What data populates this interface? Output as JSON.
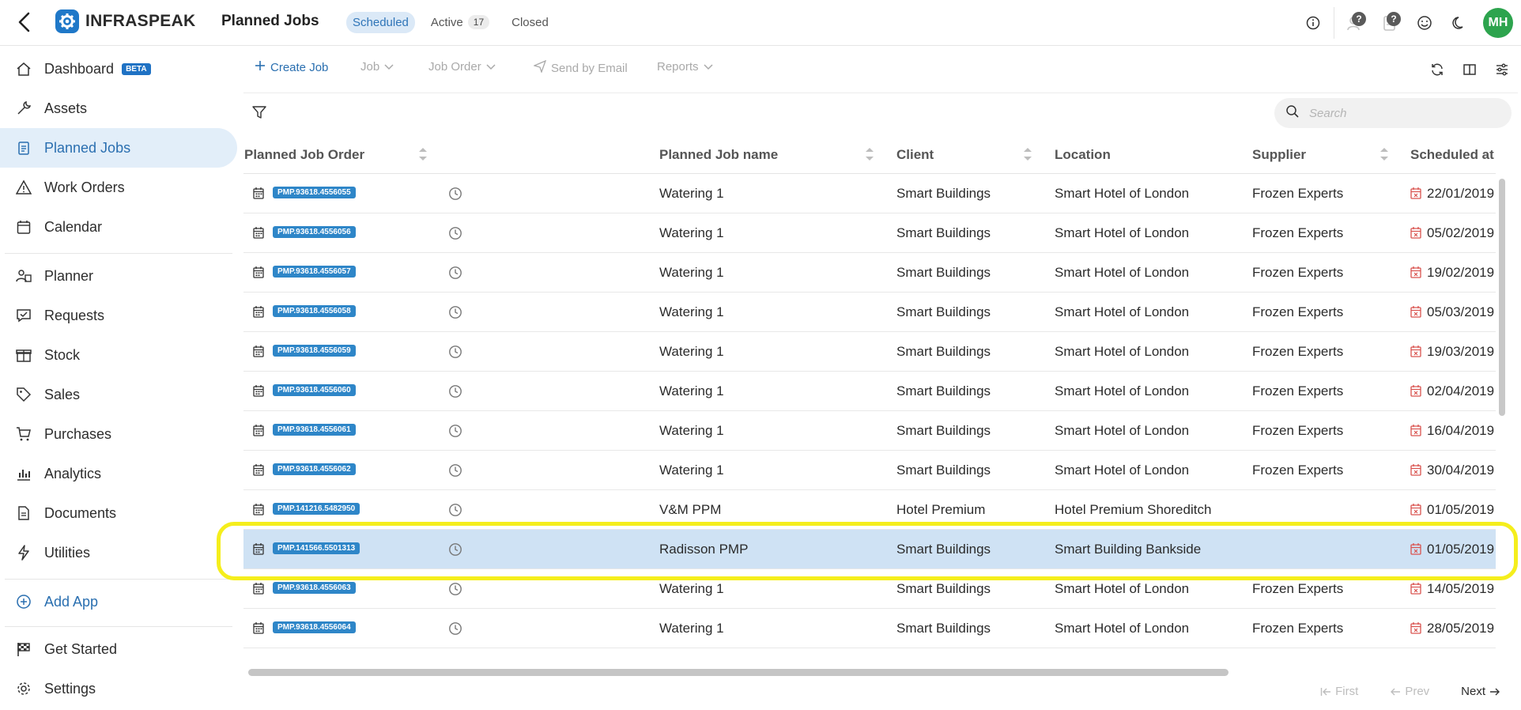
{
  "header": {
    "logo_text": "INFRASPEAK",
    "page_title": "Planned Jobs",
    "tabs": [
      {
        "label": "Scheduled",
        "active": true
      },
      {
        "label": "Active",
        "count": "17"
      },
      {
        "label": "Closed"
      }
    ],
    "help_badge": "?",
    "avatar_initials": "MH",
    "avatar_color": "#2da44e"
  },
  "sidebar": {
    "items": [
      {
        "label": "Dashboard",
        "badge": "BETA"
      },
      {
        "label": "Assets"
      },
      {
        "label": "Planned Jobs"
      },
      {
        "label": "Work Orders"
      },
      {
        "label": "Calendar"
      },
      {
        "label": "Planner"
      },
      {
        "label": "Requests"
      },
      {
        "label": "Stock"
      },
      {
        "label": "Sales"
      },
      {
        "label": "Purchases"
      },
      {
        "label": "Analytics"
      },
      {
        "label": "Documents"
      },
      {
        "label": "Utilities"
      },
      {
        "label": "Add App"
      },
      {
        "label": "Get Started"
      },
      {
        "label": "Settings"
      }
    ]
  },
  "toolbar": {
    "create_job": "Create Job",
    "job": "Job",
    "job_order": "Job Order",
    "send_email": "Send by Email",
    "reports": "Reports"
  },
  "search": {
    "placeholder": "Search"
  },
  "table": {
    "columns": [
      "Planned Job Order",
      "Planned Job name",
      "Client",
      "Location",
      "Supplier",
      "Scheduled at"
    ],
    "rows": [
      {
        "order": "PMP.93618.4556055",
        "name": "Watering 1",
        "client": "Smart Buildings",
        "location": "Smart Hotel of London",
        "supplier": "Frozen Experts",
        "date": "22/01/2019"
      },
      {
        "order": "PMP.93618.4556056",
        "name": "Watering 1",
        "client": "Smart Buildings",
        "location": "Smart Hotel of London",
        "supplier": "Frozen Experts",
        "date": "05/02/2019"
      },
      {
        "order": "PMP.93618.4556057",
        "name": "Watering 1",
        "client": "Smart Buildings",
        "location": "Smart Hotel of London",
        "supplier": "Frozen Experts",
        "date": "19/02/2019"
      },
      {
        "order": "PMP.93618.4556058",
        "name": "Watering 1",
        "client": "Smart Buildings",
        "location": "Smart Hotel of London",
        "supplier": "Frozen Experts",
        "date": "05/03/2019"
      },
      {
        "order": "PMP.93618.4556059",
        "name": "Watering 1",
        "client": "Smart Buildings",
        "location": "Smart Hotel of London",
        "supplier": "Frozen Experts",
        "date": "19/03/2019"
      },
      {
        "order": "PMP.93618.4556060",
        "name": "Watering 1",
        "client": "Smart Buildings",
        "location": "Smart Hotel of London",
        "supplier": "Frozen Experts",
        "date": "02/04/2019"
      },
      {
        "order": "PMP.93618.4556061",
        "name": "Watering 1",
        "client": "Smart Buildings",
        "location": "Smart Hotel of London",
        "supplier": "Frozen Experts",
        "date": "16/04/2019"
      },
      {
        "order": "PMP.93618.4556062",
        "name": "Watering 1",
        "client": "Smart Buildings",
        "location": "Smart Hotel of London",
        "supplier": "Frozen Experts",
        "date": "30/04/2019"
      },
      {
        "order": "PMP.141216.5482950",
        "name": "V&M PPM",
        "client": "Hotel Premium",
        "location": "Hotel Premium Shoreditch",
        "supplier": "",
        "date": "01/05/2019"
      },
      {
        "order": "PMP.141566.5501313",
        "name": "Radisson PMP",
        "client": "Smart Buildings",
        "location": "Smart Building Bankside",
        "supplier": "",
        "date": "01/05/2019",
        "selected": true
      },
      {
        "order": "PMP.93618.4556063",
        "name": "Watering 1",
        "client": "Smart Buildings",
        "location": "Smart Hotel of London",
        "supplier": "Frozen Experts",
        "date": "14/05/2019"
      },
      {
        "order": "PMP.93618.4556064",
        "name": "Watering 1",
        "client": "Smart Buildings",
        "location": "Smart Hotel of London",
        "supplier": "Frozen Experts",
        "date": "28/05/2019"
      }
    ]
  },
  "pager": {
    "first": "First",
    "prev": "Prev",
    "next": "Next"
  },
  "colors": {
    "accent": "#2a6fb0",
    "badge": "#2e86c8",
    "selected_row": "#cfe2f4",
    "highlight": "#f5ee1c",
    "date_icon": "#d9534f"
  }
}
